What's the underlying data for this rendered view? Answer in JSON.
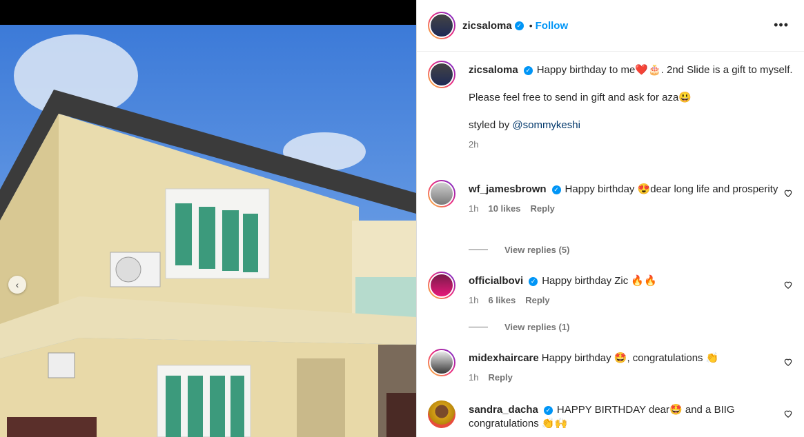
{
  "post": {
    "author": "zicsaloma",
    "follow_label": "Follow",
    "dot": "•",
    "more_label": "•••",
    "caption": {
      "line1": "Happy birthday to me❤️🎂. 2nd Slide is a gift to myself.",
      "line2": "Please feel free to send in gift and ask for aza😃",
      "styled_prefix": "styled by ",
      "styled_mention": "@sommykeshi",
      "time": "2h"
    }
  },
  "comments": [
    {
      "user": "wf_jamesbrown",
      "verified": true,
      "text": "Happy birthday 😍dear long life and prosperity",
      "time": "1h",
      "likes": "10 likes",
      "reply": "Reply",
      "view_replies": "View replies (5)"
    },
    {
      "user": "officialbovi",
      "verified": true,
      "text": "Happy birthday Zic 🔥🔥",
      "time": "1h",
      "likes": "6 likes",
      "reply": "Reply",
      "view_replies": "View replies (1)"
    },
    {
      "user": "midexhaircare",
      "verified": false,
      "text": "Happy birthday 🤩, congratulations 👏",
      "time": "1h",
      "reply": "Reply"
    },
    {
      "user": "sandra_dacha",
      "verified": true,
      "text": "HAPPY BIRTHDAY dear🤩 and a BIIG congratulations 👏🙌"
    }
  ],
  "colors": {
    "accent": "#0095f6",
    "text": "#262626",
    "muted": "#737373",
    "mention": "#00376b"
  },
  "icons": {
    "prev": "chevron-left-icon",
    "heart": "heart-icon",
    "verified": "verified-badge-icon",
    "more": "more-options-icon"
  }
}
